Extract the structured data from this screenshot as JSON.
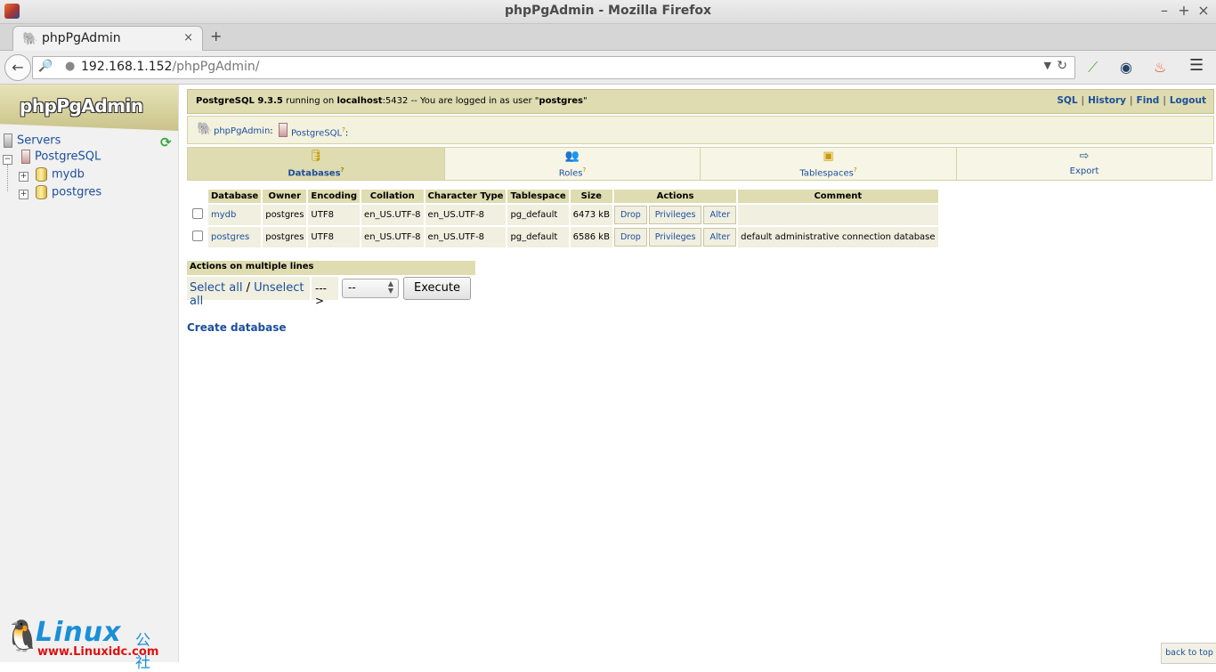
{
  "window": {
    "title": "phpPgAdmin - Mozilla Firefox"
  },
  "tab": {
    "label": "phpPgAdmin",
    "close": "×",
    "new": "+"
  },
  "nav": {
    "url_host": "192.168.1.152",
    "url_path": "/phpPgAdmin/"
  },
  "sidebar": {
    "logo": "phpPgAdmin",
    "servers": "Servers",
    "server": "PostgreSQL",
    "databases": [
      "mydb",
      "postgres"
    ]
  },
  "topbar": {
    "server_version": "PostgreSQL 9.3.5",
    "running_on": " running on ",
    "host": "localhost",
    "port": ":5432",
    "logged_in": " -- You are logged in as user \"",
    "user": "postgres",
    "end": "\"",
    "links": [
      "SQL",
      "History",
      "Find",
      "Logout"
    ]
  },
  "trail": {
    "app": "phpPgAdmin",
    "server": "PostgreSQL"
  },
  "tabs": [
    "Databases",
    "Roles",
    "Tablespaces",
    "Export"
  ],
  "table": {
    "headers": [
      "Database",
      "Owner",
      "Encoding",
      "Collation",
      "Character Type",
      "Tablespace",
      "Size",
      "Actions",
      "Comment"
    ],
    "rows": [
      {
        "name": "mydb",
        "owner": "postgres",
        "encoding": "UTF8",
        "collation": "en_US.UTF-8",
        "ctype": "en_US.UTF-8",
        "tablespace": "pg_default",
        "size": "6473 kB",
        "comment": ""
      },
      {
        "name": "postgres",
        "owner": "postgres",
        "encoding": "UTF8",
        "collation": "en_US.UTF-8",
        "ctype": "en_US.UTF-8",
        "tablespace": "pg_default",
        "size": "6586 kB",
        "comment": "default administrative connection database"
      }
    ],
    "actions": [
      "Drop",
      "Privileges",
      "Alter"
    ]
  },
  "multi": {
    "header": "Actions on multiple lines",
    "select_all": "Select all",
    "slash": " / ",
    "unselect_all": "Unselect all",
    "arrow": "--->",
    "select_value": "--",
    "execute": "Execute"
  },
  "create_db": "Create database",
  "back_to_top": "back to top",
  "watermark": {
    "brand": "Linux",
    "zh": "公社",
    "site": "www.Linuxidc.com"
  },
  "colors": {
    "header_bg": "#dedcb0",
    "link": "#1c4e9c",
    "row_bg": "#f0efe0"
  }
}
